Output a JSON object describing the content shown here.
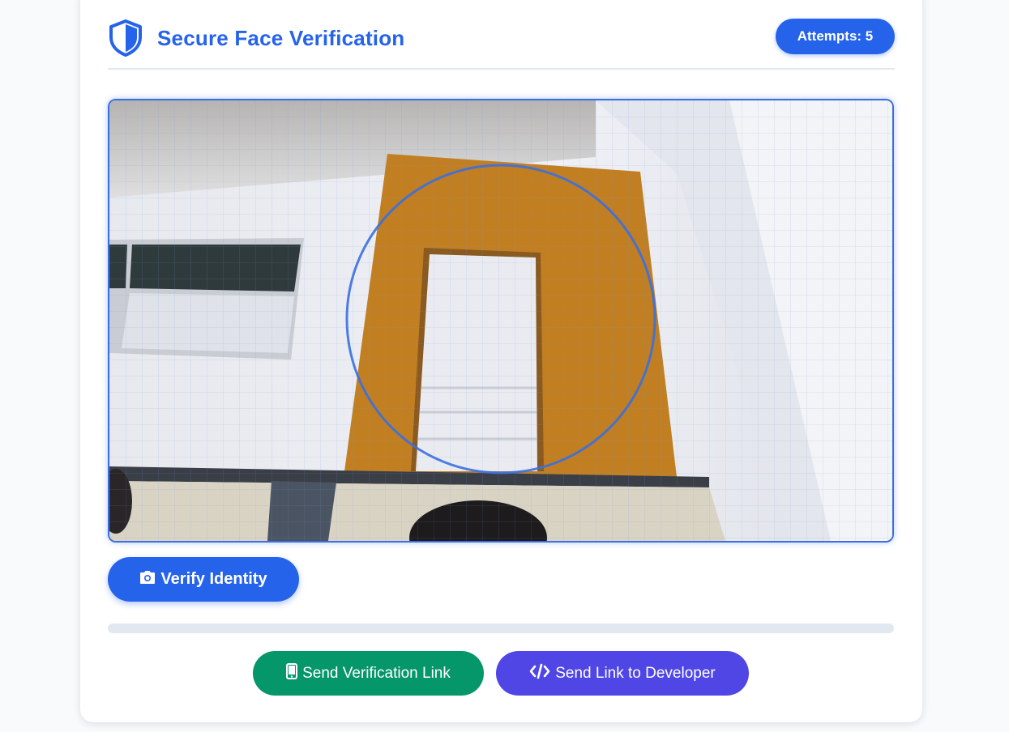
{
  "header": {
    "title": "Secure Face Verification",
    "attempts_label": "Attempts: 5",
    "icon": "shield-icon"
  },
  "camera": {
    "overlay": "face-guide-circle",
    "grid": true
  },
  "actions": {
    "verify_label": "Verify Identity",
    "verify_icon": "camera-icon",
    "send_link_label": "Send Verification Link",
    "send_link_icon": "mobile-phone-icon",
    "send_dev_label": "Send Link to Developer",
    "send_dev_icon": "code-icon"
  },
  "progress": {
    "value": 0
  },
  "colors": {
    "primary": "#2563eb",
    "success": "#059669",
    "indigo": "#4f46e5",
    "track": "#e2e8f0"
  }
}
